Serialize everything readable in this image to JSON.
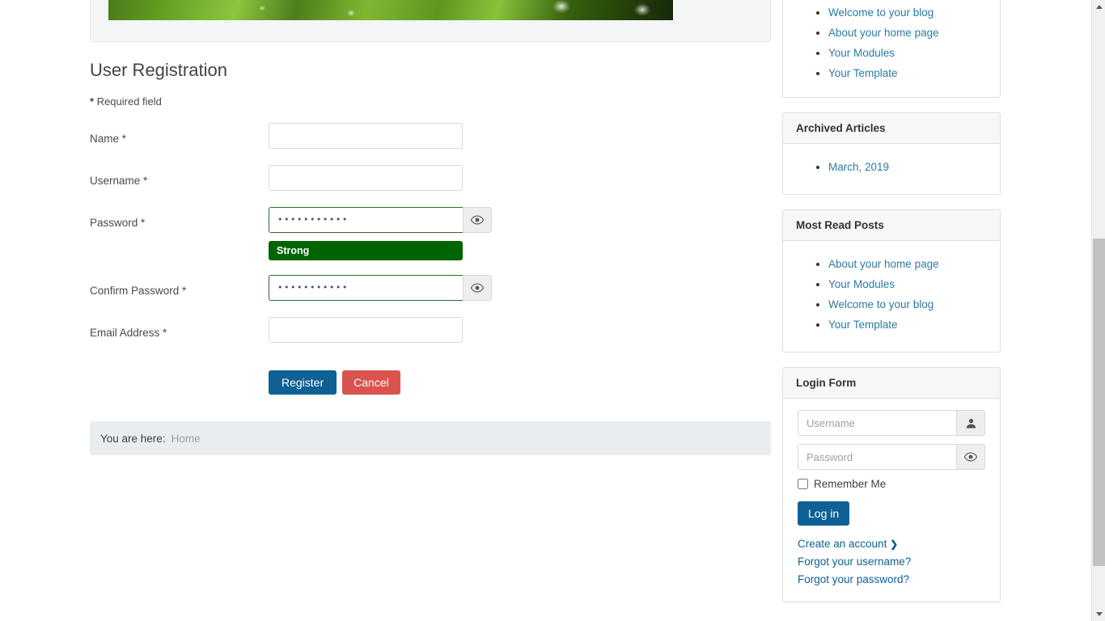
{
  "main": {
    "page_title": "User Registration",
    "required_note_star": "*",
    "required_note_text": " Required field",
    "fields": [
      {
        "label": "Name *",
        "value": "",
        "type": "text"
      },
      {
        "label": "Username *",
        "value": "",
        "type": "text"
      },
      {
        "label": "Password *",
        "value": "•••••••••••",
        "type": "password"
      },
      {
        "label": "Confirm Password *",
        "value": "•••••••••••",
        "type": "password"
      },
      {
        "label": "Email Address *",
        "value": "",
        "type": "email"
      }
    ],
    "password_strength": {
      "text": "Strong",
      "color": "#006400"
    },
    "buttons": {
      "register": "Register",
      "cancel": "Cancel",
      "register_color": "#0e6194",
      "cancel_color": "#d9534f"
    },
    "breadcrumb": {
      "label": "You are here:",
      "item": "Home"
    },
    "show_password_icon": "eye-icon"
  },
  "sidebar": {
    "latest_posts": {
      "items": [
        "Welcome to your blog",
        "About your home page",
        "Your Modules",
        "Your Template"
      ]
    },
    "archived_articles": {
      "title": "Archived Articles",
      "items": [
        "March, 2019"
      ]
    },
    "most_read_posts": {
      "title": "Most Read Posts",
      "items": [
        "About your home page",
        "Your Modules",
        "Welcome to your blog",
        "Your Template"
      ]
    },
    "login_form": {
      "title": "Login Form",
      "username_placeholder": "Username",
      "username_value": "",
      "username_icon": "user-icon",
      "password_placeholder": "Password",
      "password_value": "",
      "password_icon": "eye-icon",
      "remember_label": "Remember Me",
      "remember_checked": false,
      "login_button": "Log in",
      "login_button_color": "#0e6194",
      "links": [
        "Create an account",
        "Forgot your username?",
        "Forgot your password?"
      ],
      "create_account_chevron": "❯"
    },
    "link_color": "#2b7ba5"
  }
}
